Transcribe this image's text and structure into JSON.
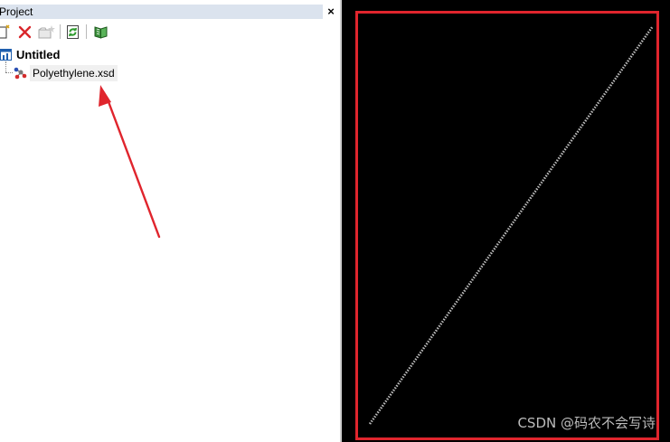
{
  "project_pane": {
    "title": "Project",
    "close_glyph": "×",
    "toolbar": [
      {
        "name": "new-item-button",
        "icon": "new-document-icon"
      },
      {
        "name": "delete-button",
        "icon": "red-x-delete-icon",
        "color": "#d9262b"
      },
      {
        "name": "add-folder-button",
        "icon": "folder-star-icon",
        "disabled": true
      },
      {
        "name": "refresh-button",
        "icon": "green-refresh-icon",
        "color": "#2e9b2e"
      },
      {
        "name": "open-book-button",
        "icon": "green-book-icon",
        "color": "#3a8f3a"
      }
    ],
    "tree": {
      "root_label": "Untitled",
      "root_icon": "project-icon",
      "children": [
        {
          "label": "Polyethylene.xsd",
          "icon": "molecule-structure-icon",
          "selected": true
        }
      ]
    },
    "annotation_color": "#e0252d"
  },
  "viewer": {
    "background": "#000000",
    "frame_color": "#e0252d",
    "polymer_chain_color": "#cfcfcf",
    "watermark": "CSDN @码农不会写诗"
  }
}
